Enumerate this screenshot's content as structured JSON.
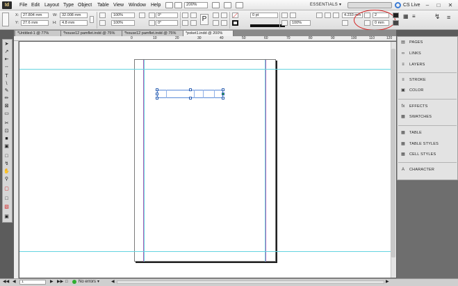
{
  "app": {
    "logo_text": "Id"
  },
  "menu": [
    "File",
    "Edit",
    "Layout",
    "Type",
    "Object",
    "Table",
    "View",
    "Window",
    "Help"
  ],
  "menubar": {
    "zoom": "200%",
    "workspace": "ESSENTIALS ▾",
    "cs_live": "CS Live"
  },
  "control": {
    "x_label": "X:",
    "x_value": "27.804 mm",
    "y_label": "Y:",
    "y_value": "27.6 mm",
    "w_label": "W:",
    "w_value": "32.008 mm",
    "h_label": "H:",
    "h_value": "4.8 mm",
    "scale_x": "100%",
    "scale_y": "100%",
    "angle": "0°",
    "shear": "0°",
    "stroke_weight": "0 pt",
    "opacity": "100%",
    "offset_value": "4.233 mm",
    "columns_value": "2",
    "gutter_value": "0 mm"
  },
  "tabs": [
    {
      "label": "*Untitled-1 @ 77%",
      "active": false
    },
    {
      "label": "*house12 pamflet.indd @ 75%",
      "active": false
    },
    {
      "label": "*house12 pamflet.indd @ 75%",
      "active": false
    },
    {
      "label": "*poket1.indd @ 200%",
      "active": true
    }
  ],
  "ruler_ticks": [
    "0",
    "10",
    "20",
    "30",
    "40",
    "50",
    "60",
    "70",
    "80",
    "90",
    "100",
    "110",
    "120"
  ],
  "panels": [
    {
      "icon": "pages-icon",
      "glyph": "▤",
      "label": "PAGES"
    },
    {
      "icon": "links-icon",
      "glyph": "∞",
      "label": "LINKS"
    },
    {
      "icon": "layers-icon",
      "glyph": "≡",
      "label": "LAYERS"
    },
    {
      "icon": "stroke-icon",
      "glyph": "≡",
      "label": "STROKE"
    },
    {
      "icon": "color-icon",
      "glyph": "▣",
      "label": "COLOR"
    },
    {
      "icon": "effects-icon",
      "glyph": "fx",
      "label": "EFFECTS"
    },
    {
      "icon": "swatches-icon",
      "glyph": "▦",
      "label": "SWATCHES"
    },
    {
      "icon": "table-icon",
      "glyph": "▦",
      "label": "TABLE"
    },
    {
      "icon": "table-styles-icon",
      "glyph": "▦",
      "label": "TABLE STYLES"
    },
    {
      "icon": "cell-styles-icon",
      "glyph": "▦",
      "label": "CELL STYLES"
    },
    {
      "icon": "character-icon",
      "glyph": "A",
      "label": "CHARACTER"
    }
  ],
  "status": {
    "page_number": "1",
    "errors_label": "No errors"
  }
}
